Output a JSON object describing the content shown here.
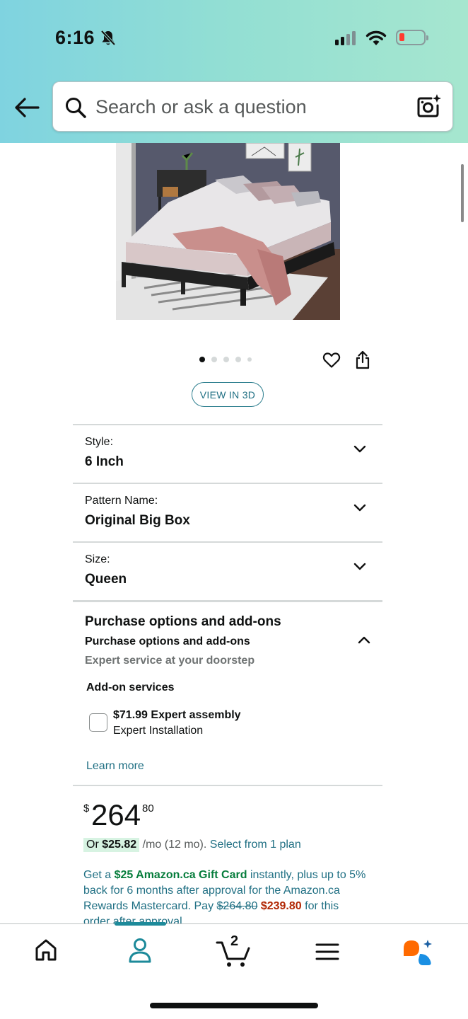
{
  "status_bar": {
    "time": "6:16"
  },
  "search": {
    "placeholder": "Search or ask a question"
  },
  "gallery": {
    "image_count": 5,
    "active_index": 0
  },
  "view3d_label": "VIEW IN 3D",
  "variations": [
    {
      "label": "Style:",
      "value": "6 Inch"
    },
    {
      "label": "Pattern Name:",
      "value": "Original Big Box"
    },
    {
      "label": "Size:",
      "value": "Queen"
    }
  ],
  "purchase_options": {
    "title": "Purchase options and add-ons",
    "subtitle": "Purchase options and add-ons",
    "description": "Expert service at your doorstep",
    "addons_title": "Add-on services",
    "addon": {
      "price": "$71.99",
      "name": "Expert assembly",
      "detail": "Expert Installation",
      "checked": false
    },
    "learn_more": "Learn more"
  },
  "price": {
    "symbol": "$",
    "whole": "264",
    "fraction": "80"
  },
  "monthly": {
    "prefix": "Or",
    "amount": "$25.82",
    "period": "/mo (12 mo).",
    "link": "Select from 1 plan"
  },
  "promo": {
    "text1": "Get a",
    "gift_card": "$25 Amazon.ca Gift Card",
    "text2": "instantly, plus up to 5% back for 6 months after approval for the Amazon.ca Rewards Mastercard.",
    "pay_label": "Pay",
    "old_price": "$264.80",
    "new_price": "$239.80",
    "tail": "for this order after approval."
  },
  "bottom_nav": {
    "cart_count": "2",
    "active_tab": "account"
  },
  "colors": {
    "header_gradient_start": "#7fd3e0",
    "header_gradient_end": "#a6e6cf",
    "link_teal": "#1f6f83",
    "gift_card_green": "#067d3c",
    "price_red": "#b12704",
    "nav_active": "#1d8a9a",
    "rufus_orange": "#ff6a00",
    "rufus_blue": "#1a8fe3"
  }
}
